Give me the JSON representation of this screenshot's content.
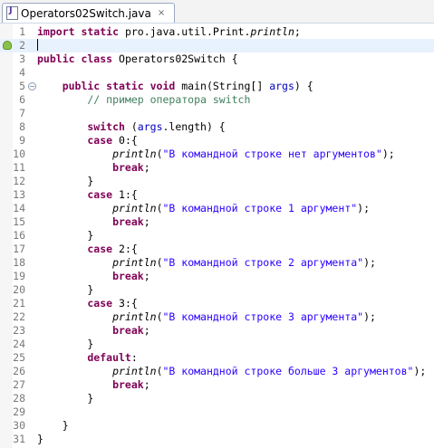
{
  "editor_tab": {
    "title": "Operators02Switch.java",
    "close_glyph": "×"
  },
  "colors": {
    "keyword": "#7f0055",
    "string": "#2a00ff",
    "comment": "#3f7f5f",
    "field": "#0000c0",
    "current_line": "#e8f2fe"
  },
  "lines": [
    {
      "n": "1",
      "tokens": [
        {
          "t": "import static ",
          "c": "kw"
        },
        {
          "t": "pro.java.util.Print."
        },
        {
          "t": "println",
          "c": "it"
        },
        {
          "t": ";"
        }
      ]
    },
    {
      "n": "2",
      "current": true,
      "bulb": true,
      "tokens": [
        {
          "t": "",
          "cursor": true
        }
      ]
    },
    {
      "n": "3",
      "tokens": [
        {
          "t": "public class ",
          "c": "kw"
        },
        {
          "t": "Operators02Switch {"
        }
      ]
    },
    {
      "n": "4",
      "tokens": []
    },
    {
      "n": "5",
      "fold": "−",
      "tokens": [
        {
          "t": "    public static void ",
          "c": "kw"
        },
        {
          "t": "main(String[] "
        },
        {
          "t": "args",
          "c": "fld"
        },
        {
          "t": ") {"
        }
      ]
    },
    {
      "n": "6",
      "tokens": [
        {
          "t": "        // пример оператора switch",
          "c": "cmt"
        }
      ]
    },
    {
      "n": "7",
      "tokens": []
    },
    {
      "n": "8",
      "tokens": [
        {
          "t": "        switch ",
          "c": "kw"
        },
        {
          "t": "("
        },
        {
          "t": "args",
          "c": "fld"
        },
        {
          "t": ".length) {"
        }
      ]
    },
    {
      "n": "9",
      "tokens": [
        {
          "t": "        case ",
          "c": "kw"
        },
        {
          "t": "0:{"
        }
      ]
    },
    {
      "n": "10",
      "tokens": [
        {
          "t": "            "
        },
        {
          "t": "println",
          "c": "it"
        },
        {
          "t": "("
        },
        {
          "t": "\"В командной строке нет аргументов\"",
          "c": "str"
        },
        {
          "t": ");"
        }
      ]
    },
    {
      "n": "11",
      "tokens": [
        {
          "t": "            break",
          "c": "kw"
        },
        {
          "t": ";"
        }
      ]
    },
    {
      "n": "12",
      "tokens": [
        {
          "t": "        }"
        }
      ]
    },
    {
      "n": "13",
      "tokens": [
        {
          "t": "        case ",
          "c": "kw"
        },
        {
          "t": "1:{"
        }
      ]
    },
    {
      "n": "14",
      "tokens": [
        {
          "t": "            "
        },
        {
          "t": "println",
          "c": "it"
        },
        {
          "t": "("
        },
        {
          "t": "\"В командной строке 1 аргумент\"",
          "c": "str"
        },
        {
          "t": ");"
        }
      ]
    },
    {
      "n": "15",
      "tokens": [
        {
          "t": "            break",
          "c": "kw"
        },
        {
          "t": ";"
        }
      ]
    },
    {
      "n": "16",
      "tokens": [
        {
          "t": "        }"
        }
      ]
    },
    {
      "n": "17",
      "tokens": [
        {
          "t": "        case ",
          "c": "kw"
        },
        {
          "t": "2:{"
        }
      ]
    },
    {
      "n": "18",
      "tokens": [
        {
          "t": "            "
        },
        {
          "t": "println",
          "c": "it"
        },
        {
          "t": "("
        },
        {
          "t": "\"В командной строке 2 аргумента\"",
          "c": "str"
        },
        {
          "t": ");"
        }
      ]
    },
    {
      "n": "19",
      "tokens": [
        {
          "t": "            break",
          "c": "kw"
        },
        {
          "t": ";"
        }
      ]
    },
    {
      "n": "20",
      "tokens": [
        {
          "t": "        }"
        }
      ]
    },
    {
      "n": "21",
      "tokens": [
        {
          "t": "        case ",
          "c": "kw"
        },
        {
          "t": "3:{"
        }
      ]
    },
    {
      "n": "22",
      "tokens": [
        {
          "t": "            "
        },
        {
          "t": "println",
          "c": "it"
        },
        {
          "t": "("
        },
        {
          "t": "\"В командной строке 3 аргумента\"",
          "c": "str"
        },
        {
          "t": ");"
        }
      ]
    },
    {
      "n": "23",
      "tokens": [
        {
          "t": "            break",
          "c": "kw"
        },
        {
          "t": ";"
        }
      ]
    },
    {
      "n": "24",
      "tokens": [
        {
          "t": "        }"
        }
      ]
    },
    {
      "n": "25",
      "tokens": [
        {
          "t": "        default",
          "c": "kw"
        },
        {
          "t": ":"
        }
      ]
    },
    {
      "n": "26",
      "tokens": [
        {
          "t": "            "
        },
        {
          "t": "println",
          "c": "it"
        },
        {
          "t": "("
        },
        {
          "t": "\"В командной строке больше 3 аргументов\"",
          "c": "str"
        },
        {
          "t": ");"
        }
      ]
    },
    {
      "n": "27",
      "tokens": [
        {
          "t": "            break",
          "c": "kw"
        },
        {
          "t": ";"
        }
      ]
    },
    {
      "n": "28",
      "tokens": [
        {
          "t": "        }"
        }
      ]
    },
    {
      "n": "29",
      "tokens": []
    },
    {
      "n": "30",
      "tokens": [
        {
          "t": "    }"
        }
      ]
    },
    {
      "n": "31",
      "tokens": [
        {
          "t": "}"
        }
      ]
    }
  ]
}
